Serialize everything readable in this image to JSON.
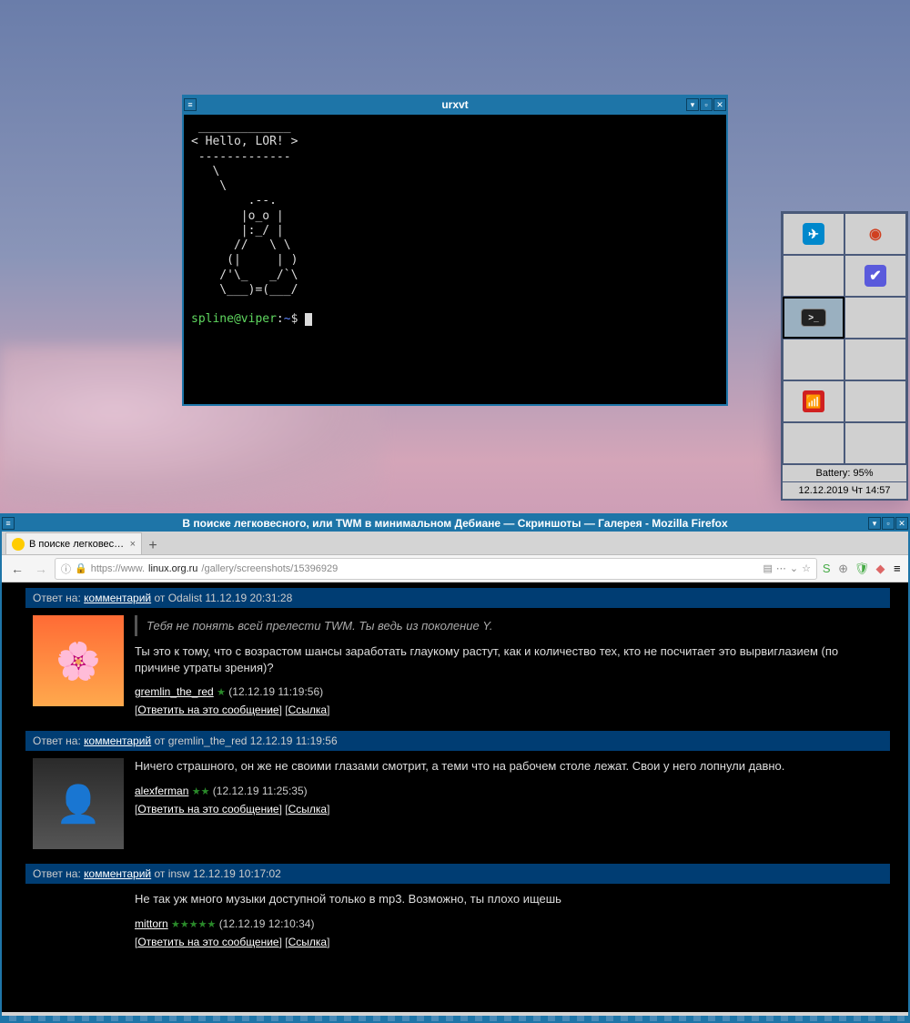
{
  "terminal": {
    "title": "urxvt",
    "ascii": " _____________\n< Hello, LOR! >\n -------------\n   \\\n    \\\n        .--.\n       |o_o |\n       |:_/ |\n      //   \\ \\\n     (|     | )\n    /'\\_   _/`\\\n    \\___)=(___/",
    "prompt_user": "spline@viper",
    "prompt_sep": ":",
    "prompt_path": "~",
    "prompt_end": "$"
  },
  "pager": {
    "battery": "Battery: 95%",
    "datetime": "12.12.2019 Чт 14:57"
  },
  "firefox": {
    "title": "В поиске легковесного, или TWM в минимальном Дебиане — Скриншоты — Галерея - Mozilla Firefox",
    "tab_label": "В поиске легковесного",
    "url_prefix": "https://www.",
    "url_host": "linux.org.ru",
    "url_path": "/gallery/screenshots/15396929"
  },
  "comments": [
    {
      "head_prefix": "Ответ на: ",
      "head_link": "комментарий",
      "head_suffix": " от Odalist 11.12.19 20:31:28",
      "quote": "Тебя не понять всей прелести TWM. Ты ведь из поколение Y.",
      "msg": "Ты это к тому, что с возрастом шансы заработать глаукому растут, как и количество тех, кто не посчитает это вырвиглазием (по причине утраты зрения)?",
      "author": "gremlin_the_red",
      "stars": "★",
      "time": "(12.12.19 11:19:56)",
      "reply": "Ответить на это сообщение",
      "link": "Ссылка",
      "avatar": "av1"
    },
    {
      "head_prefix": "Ответ на: ",
      "head_link": "комментарий",
      "head_suffix": " от gremlin_the_red 12.12.19 11:19:56",
      "quote": "",
      "msg": "Ничего страшного, он же не своими глазами смотрит, а теми что на рабочем столе лежат. Свои у него лопнули давно.",
      "author": "alexferman",
      "stars": "★★",
      "time": "(12.12.19 11:25:35)",
      "reply": "Ответить на это сообщение",
      "link": "Ссылка",
      "avatar": "av2"
    },
    {
      "head_prefix": "Ответ на: ",
      "head_link": "комментарий",
      "head_suffix": " от insw 12.12.19 10:17:02",
      "quote": "",
      "msg": "Не так уж много музыки доступной только в mp3. Возможно, ты плохо ищешь",
      "author": "mittorn",
      "stars": "★★★★★",
      "time": "(12.12.19 12:10:34)",
      "reply": "Ответить на это сообщение",
      "link": "Ссылка",
      "avatar": "av3"
    }
  ]
}
